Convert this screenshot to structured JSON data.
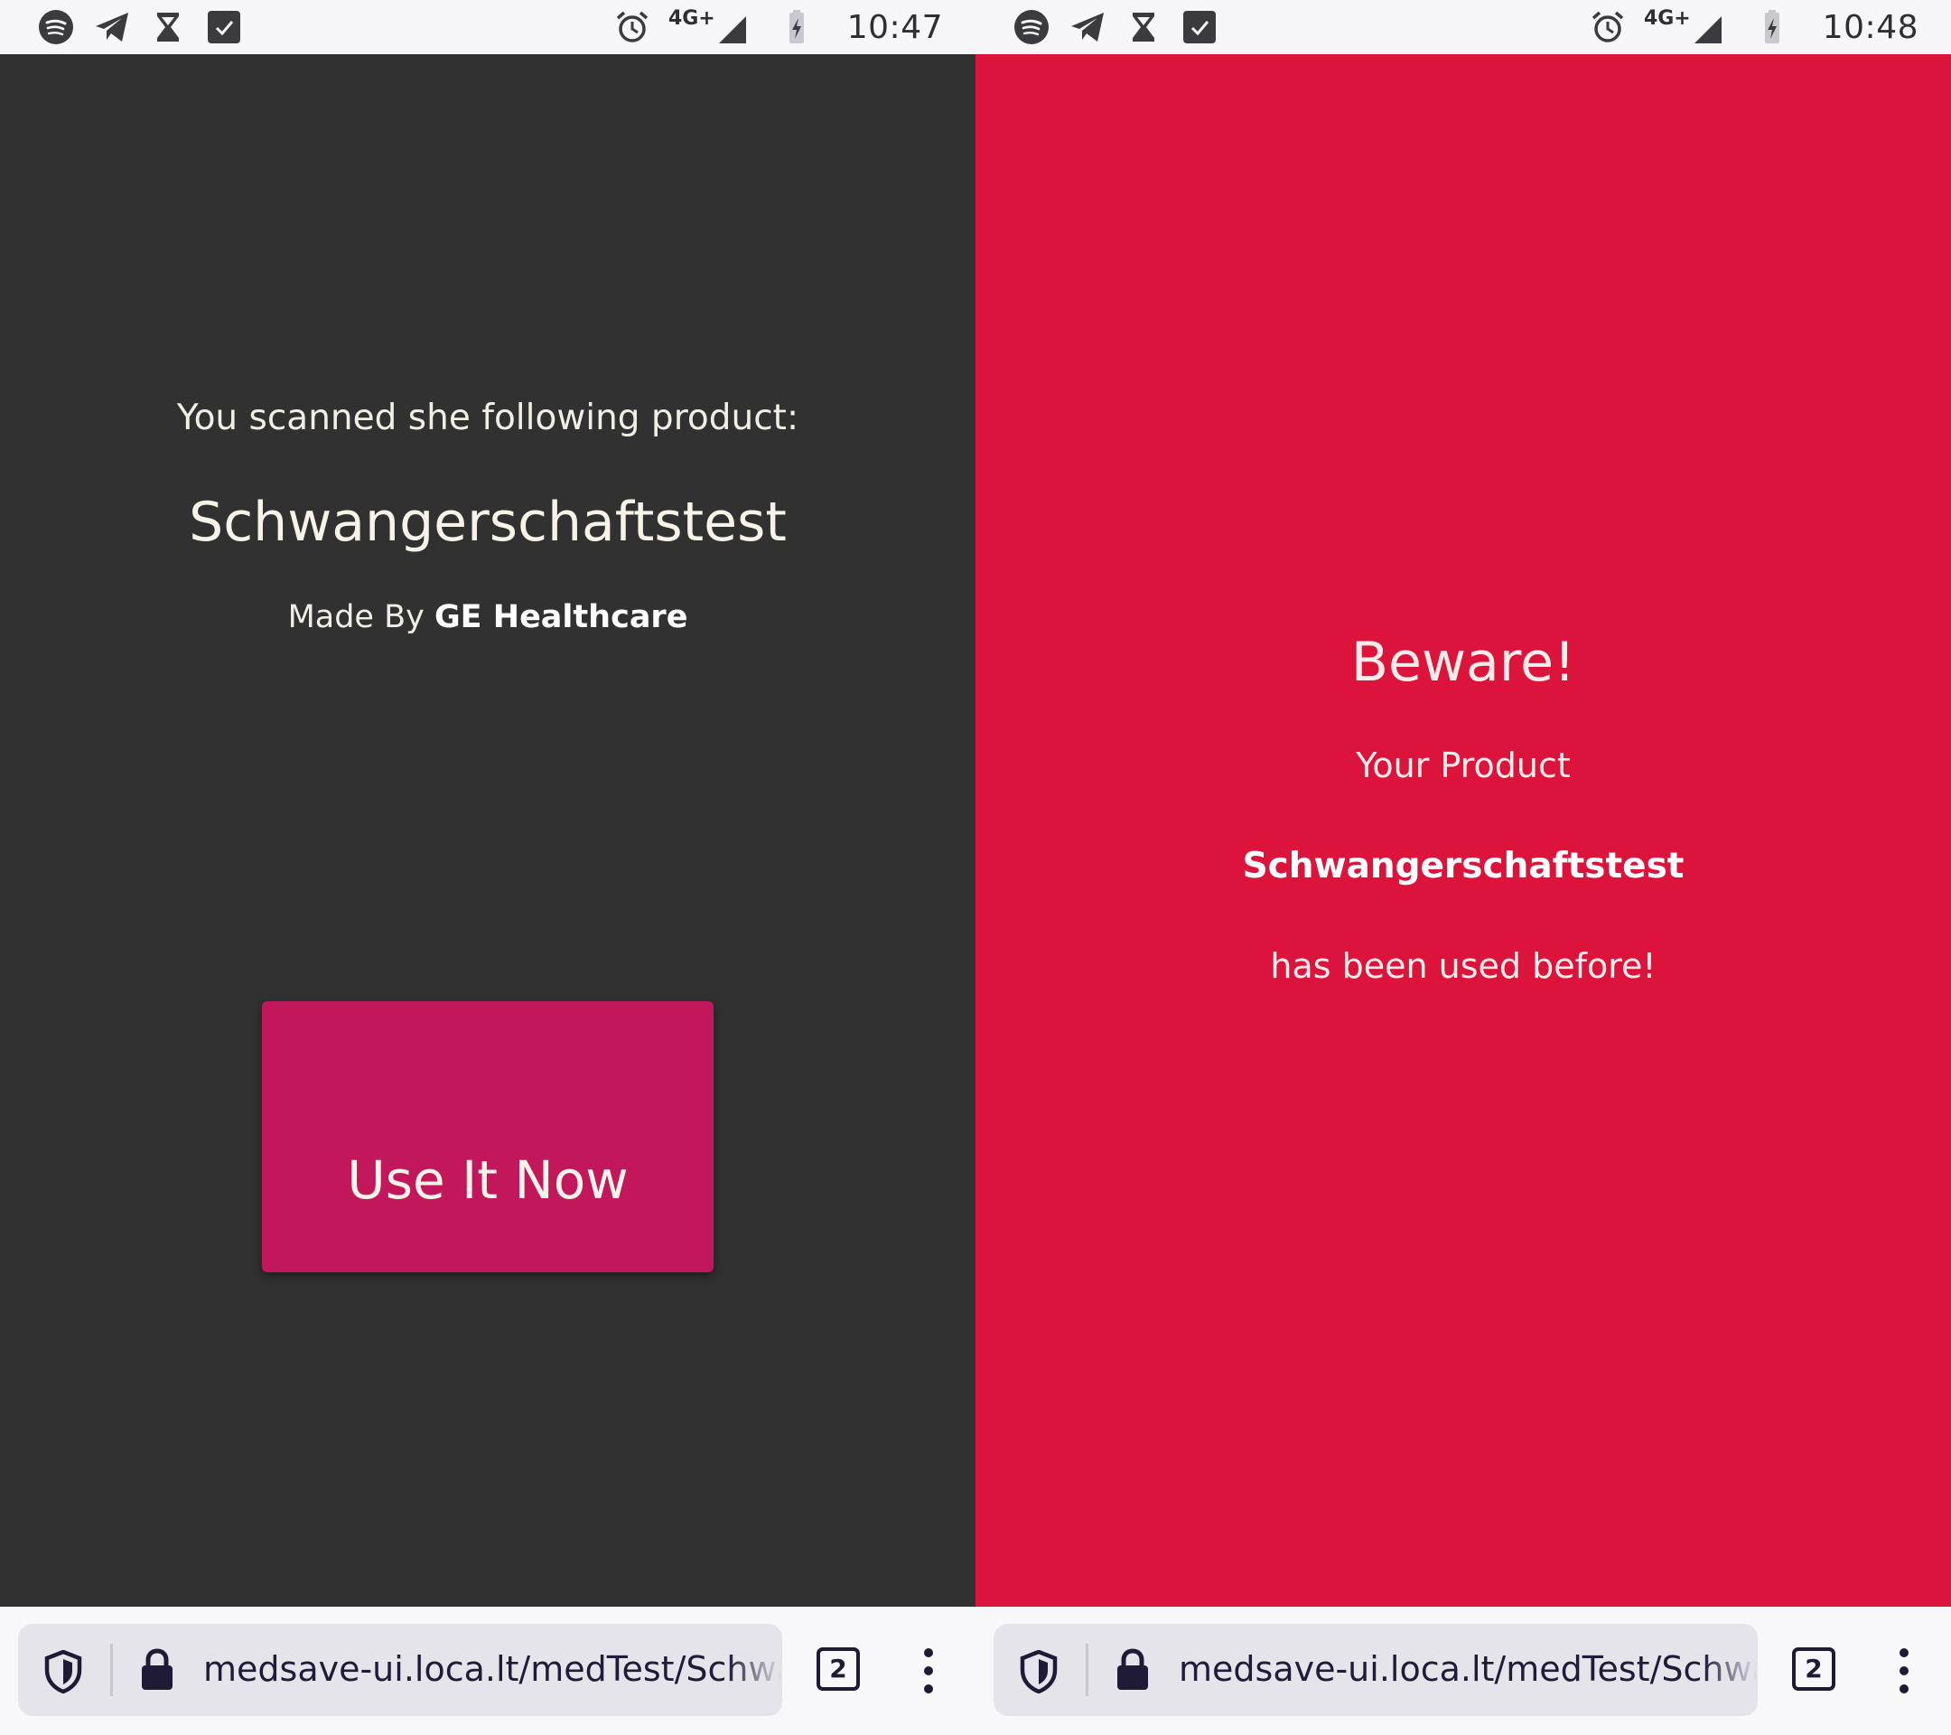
{
  "left_phone": {
    "status_bar": {
      "time": "10:47",
      "network": "4G+",
      "notification_icons": [
        "spotify-icon",
        "telegram-icon",
        "hourglass-icon",
        "checkbox-icon"
      ],
      "system_icons": [
        "alarm-icon",
        "signal-icon",
        "battery-charging-icon"
      ]
    },
    "content": {
      "background_color": "#313131",
      "intro_text": "You scanned she following product:",
      "product_name": "Schwangerschaftstest",
      "made_by_prefix": "Made By",
      "manufacturer": "GE Healthcare",
      "action_button_label": "Use It Now",
      "action_button_color": "#c2185b"
    },
    "browser": {
      "url": "medsave-ui.loca.lt/medTest/Schwangerschaftstest",
      "tab_count": "2"
    }
  },
  "right_phone": {
    "status_bar": {
      "time": "10:48",
      "network": "4G+",
      "notification_icons": [
        "spotify-icon",
        "telegram-icon",
        "hourglass-icon",
        "checkbox-icon"
      ],
      "system_icons": [
        "alarm-icon",
        "signal-icon",
        "battery-charging-icon"
      ]
    },
    "content": {
      "background_color": "#dc143c",
      "warning_title": "Beware!",
      "your_product_text": "Your Product",
      "product_name": "Schwangerschaftstest",
      "used_before_text": "has been used before!"
    },
    "browser": {
      "url": "medsave-ui.loca.lt/medTest/Schwangerschaftstest",
      "tab_count": "2"
    }
  }
}
